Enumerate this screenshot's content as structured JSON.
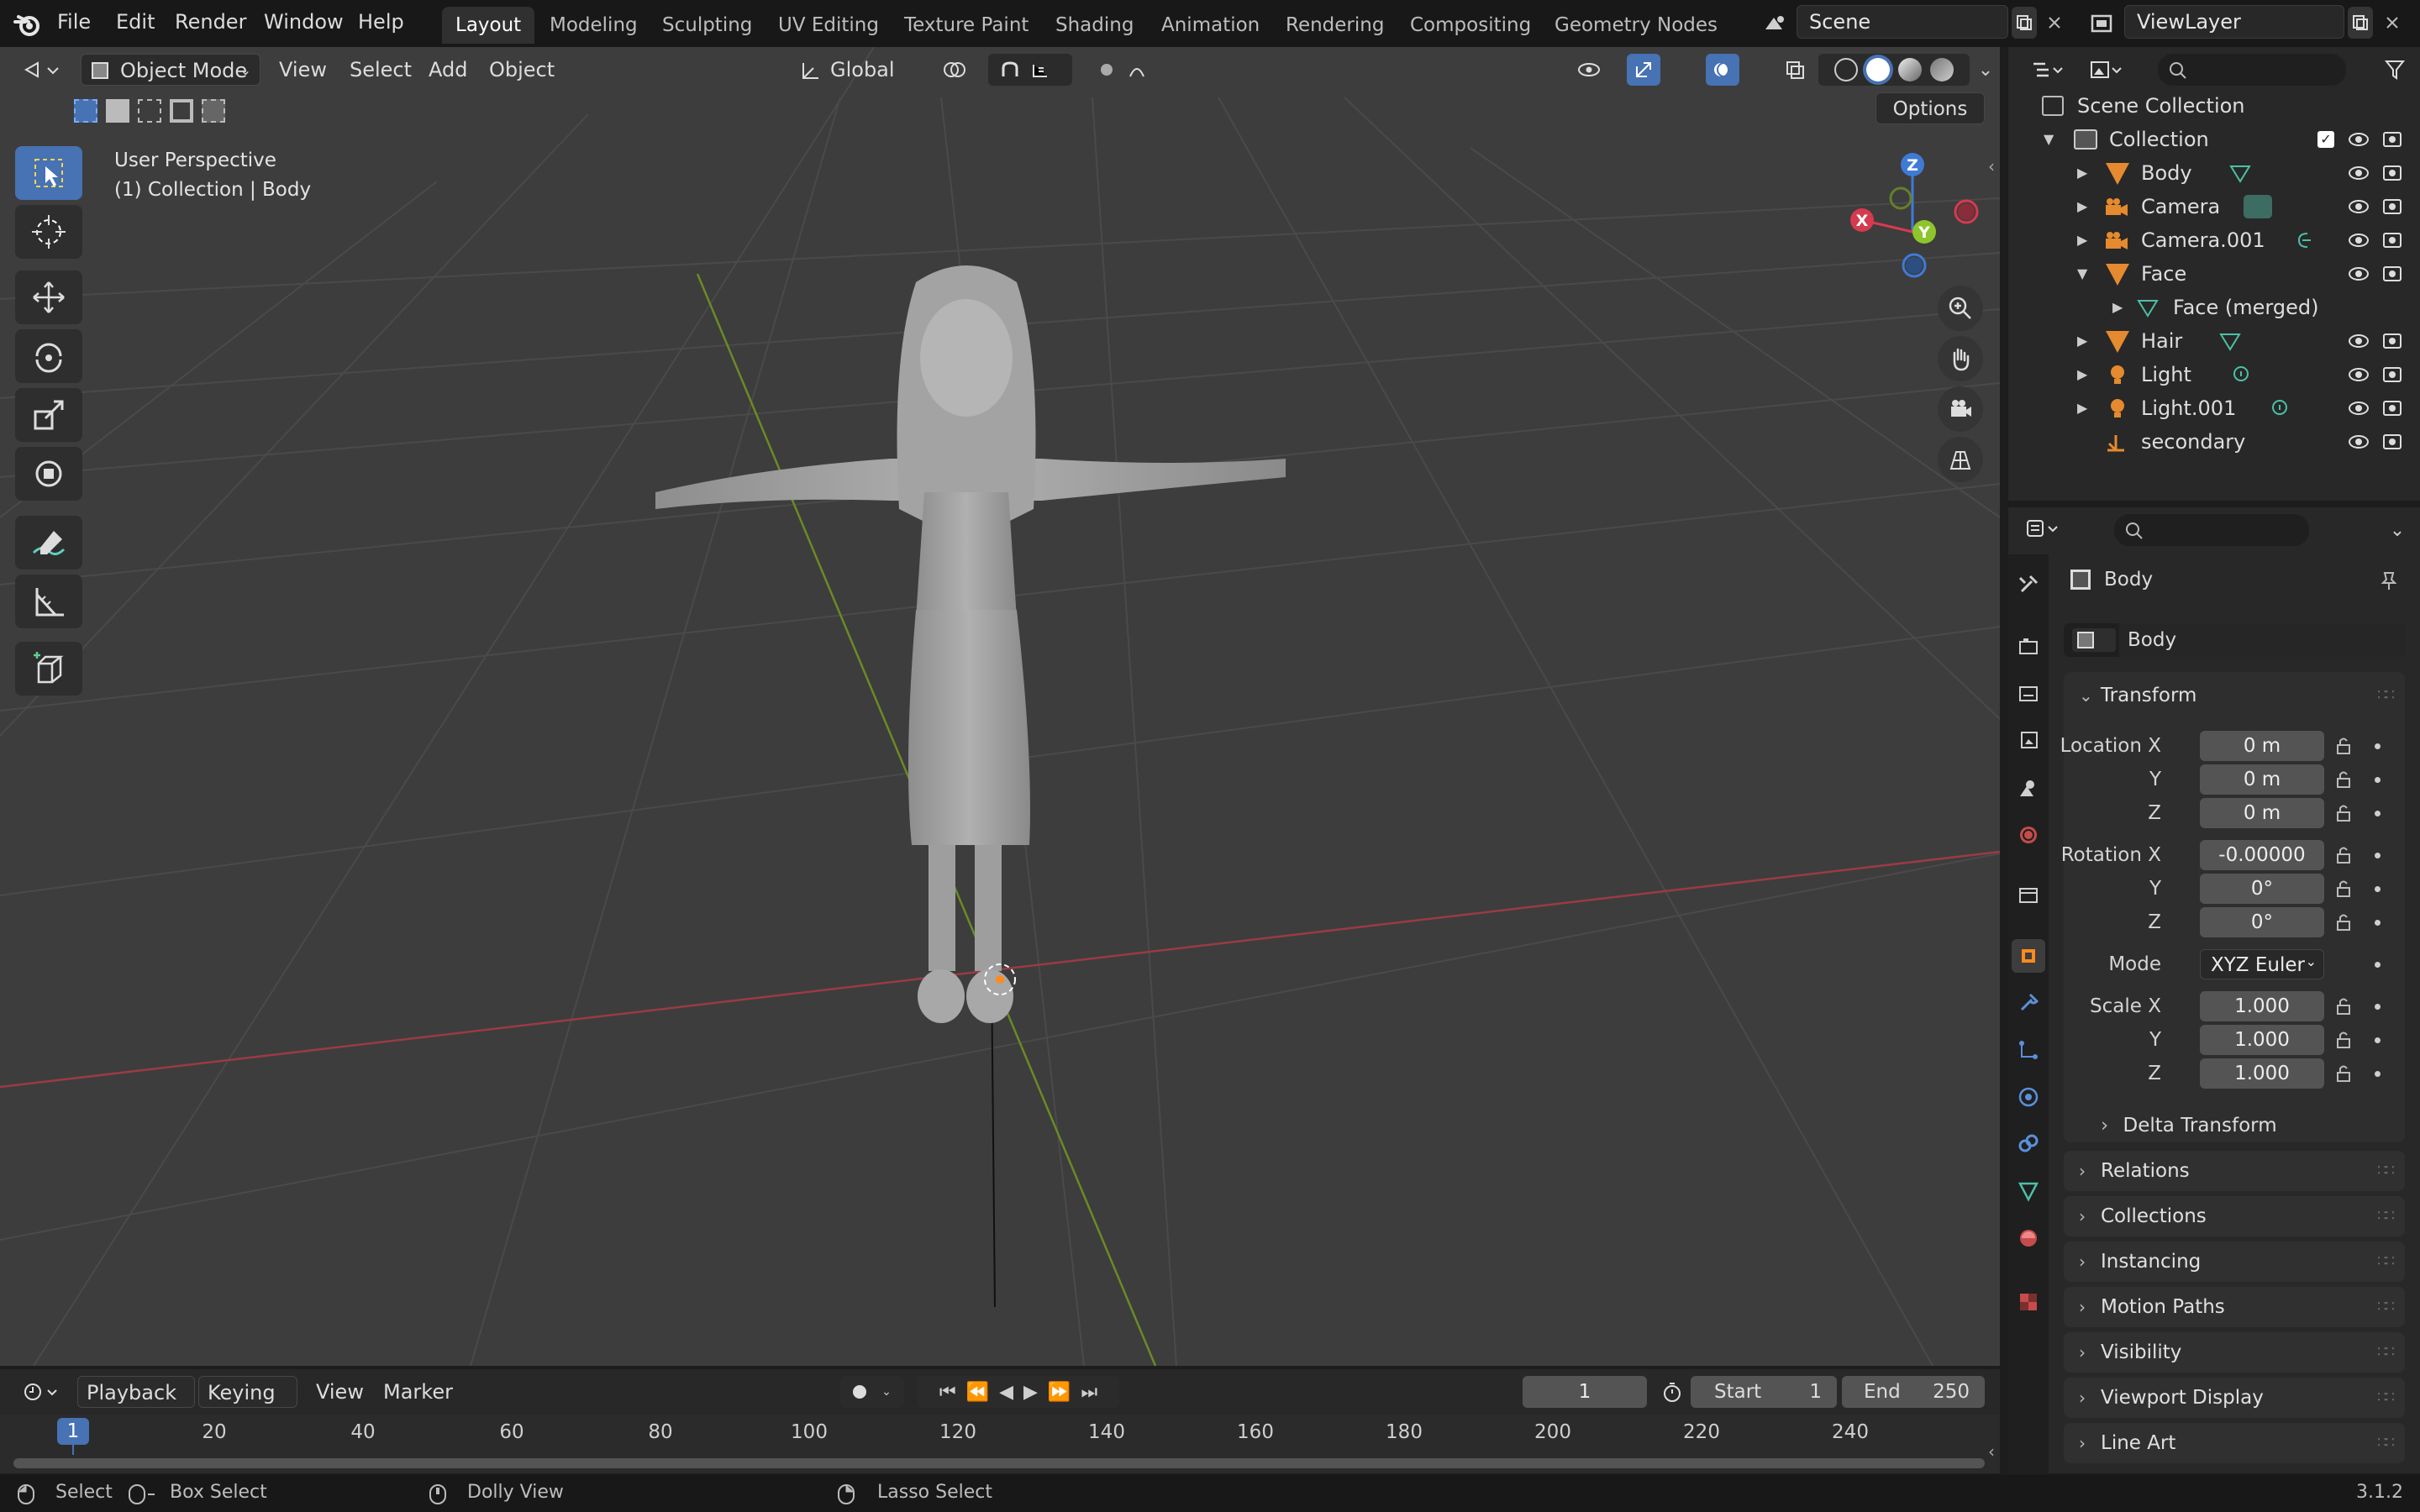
{
  "top_menu": [
    "File",
    "Edit",
    "Render",
    "Window",
    "Help"
  ],
  "workspaces": [
    "Layout",
    "Modeling",
    "Sculpting",
    "UV Editing",
    "Texture Paint",
    "Shading",
    "Animation",
    "Rendering",
    "Compositing",
    "Geometry Nodes"
  ],
  "active_workspace": "Layout",
  "scene_name": "Scene",
  "view_layer_name": "ViewLayer",
  "viewport_header": {
    "mode": "Object Mode",
    "menus": [
      "View",
      "Select",
      "Add",
      "Object"
    ],
    "orientation": "Global",
    "options_label": "Options"
  },
  "viewport_overlay": {
    "line1": "User Perspective",
    "line2": "(1) Collection | Body"
  },
  "gizmo_axes": {
    "z": "Z",
    "y": "Y",
    "x": "X"
  },
  "outliner": {
    "scene_collection": "Scene Collection",
    "collection": "Collection",
    "items": [
      {
        "label": "Body",
        "icon": "mesh-icon"
      },
      {
        "label": "Camera",
        "icon": "camera-icon"
      },
      {
        "label": "Camera.001",
        "icon": "camera-icon"
      },
      {
        "label": "Face",
        "icon": "mesh-icon"
      },
      {
        "label": "Face (merged)",
        "icon": "mesh-data-icon"
      },
      {
        "label": "Hair",
        "icon": "mesh-icon"
      },
      {
        "label": "Light",
        "icon": "light-icon"
      },
      {
        "label": "Light.001",
        "icon": "light-icon"
      },
      {
        "label": "secondary",
        "icon": "empty-icon"
      }
    ]
  },
  "properties": {
    "object_name": "Body",
    "object_field": "Body",
    "transform_title": "Transform",
    "location_label": "Location X",
    "y_label": "Y",
    "z_label": "Z",
    "location": {
      "x": "0 m",
      "y": "0 m",
      "z": "0 m"
    },
    "rotation_label": "Rotation X",
    "rotation": {
      "x": "-0.00000",
      "y": "0°",
      "z": "0°"
    },
    "mode_label": "Mode",
    "mode_value": "XYZ Euler",
    "scale_label": "Scale X",
    "scale": {
      "x": "1.000",
      "y": "1.000",
      "z": "1.000"
    },
    "delta_transform": "Delta Transform",
    "collapsed_panels": [
      "Relations",
      "Collections",
      "Instancing",
      "Motion Paths",
      "Visibility",
      "Viewport Display",
      "Line Art"
    ]
  },
  "timeline": {
    "menus": [
      "Playback",
      "Keying",
      "View",
      "Marker"
    ],
    "current_frame": "1",
    "start_label": "Start",
    "start_value": "1",
    "end_label": "End",
    "end_value": "250",
    "ticks": [
      "20",
      "40",
      "60",
      "80",
      "100",
      "120",
      "140",
      "160",
      "180",
      "200",
      "220",
      "240"
    ],
    "cursor_frame": "1"
  },
  "statusbar": {
    "select": "Select",
    "box_select": "Box Select",
    "dolly_view": "Dolly View",
    "lasso_select": "Lasso Select",
    "version": "3.1.2"
  }
}
